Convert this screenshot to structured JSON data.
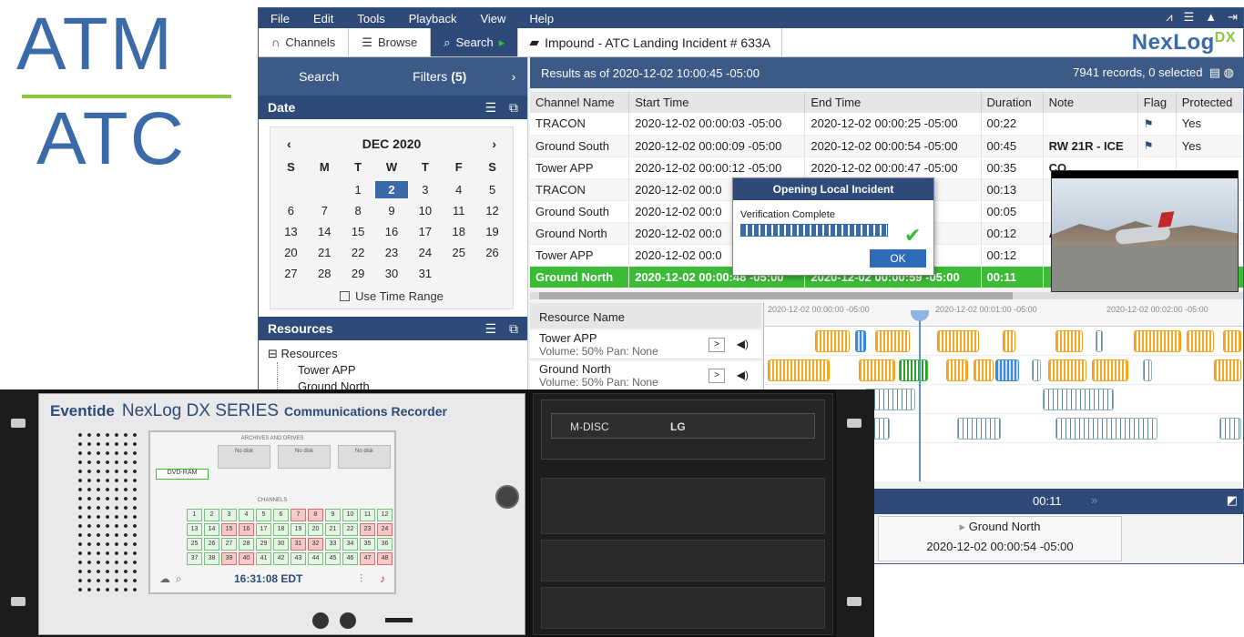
{
  "logo": {
    "top": "ATM",
    "bottom": "ATC"
  },
  "menu": [
    "File",
    "Edit",
    "Tools",
    "Playback",
    "View",
    "Help"
  ],
  "tabs": {
    "channels": "Channels",
    "browse": "Browse",
    "search": "Search",
    "document": "Impound - ATC Landing Incident # 633A"
  },
  "brand": {
    "name": "NexLog",
    "suffix": "DX"
  },
  "left_tabs": {
    "search": "Search",
    "filters": "Filters",
    "filters_count": "(5)"
  },
  "date_section": "Date",
  "calendar": {
    "month": "DEC 2020",
    "dow": [
      "S",
      "M",
      "T",
      "W",
      "T",
      "F",
      "S"
    ],
    "weeks": [
      [
        "",
        "",
        "1",
        "2",
        "3",
        "4",
        "5"
      ],
      [
        "6",
        "7",
        "8",
        "9",
        "10",
        "11",
        "12"
      ],
      [
        "13",
        "14",
        "15",
        "16",
        "17",
        "18",
        "19"
      ],
      [
        "20",
        "21",
        "22",
        "23",
        "24",
        "25",
        "26"
      ],
      [
        "27",
        "28",
        "29",
        "30",
        "31",
        "",
        ""
      ]
    ],
    "selected": "2",
    "use_time_range": "Use Time Range"
  },
  "resources_section": "Resources",
  "resource_tree": {
    "root": "Resources",
    "children": [
      "Tower APP",
      "Ground North"
    ]
  },
  "results": {
    "as_of": "Results as of 2020-12-02 10:00:45 -05:00",
    "count": "7941 records, 0 selected"
  },
  "columns": [
    "Channel Name",
    "Start Time",
    "End Time",
    "Duration",
    "Note",
    "Flag",
    "Protected"
  ],
  "rows": [
    {
      "channel": "TRACON",
      "start": "2020-12-02 00:00:03 -05:00",
      "end": "2020-12-02 00:00:25 -05:00",
      "dur": "00:22",
      "note": "",
      "flag": "⚑",
      "prot": "Yes"
    },
    {
      "channel": "Ground South",
      "start": "2020-12-02 00:00:09 -05:00",
      "end": "2020-12-02 00:00:54 -05:00",
      "dur": "00:45",
      "note": "RW 21R - ICE",
      "flag": "⚑",
      "prot": "Yes"
    },
    {
      "channel": "Tower APP",
      "start": "2020-12-02 00:00:12 -05:00",
      "end": "2020-12-02 00:00:47 -05:00",
      "dur": "00:35",
      "note": "CO",
      "flag": "",
      "prot": ""
    },
    {
      "channel": "TRACON",
      "start": "2020-12-02 00:0",
      "end": "5:00",
      "dur": "00:13",
      "note": "",
      "flag": "",
      "prot": ""
    },
    {
      "channel": "Ground South",
      "start": "2020-12-02 00:0",
      "end": "5:00",
      "dur": "00:05",
      "note": "",
      "flag": "",
      "prot": ""
    },
    {
      "channel": "Ground North",
      "start": "2020-12-02 00:0",
      "end": "5:00",
      "dur": "00:12",
      "note": "AL",
      "flag": "",
      "prot": ""
    },
    {
      "channel": "Tower APP",
      "start": "2020-12-02 00:0",
      "end": "5:00",
      "dur": "00:12",
      "note": "",
      "flag": "",
      "prot": ""
    },
    {
      "channel": "Ground North",
      "start": "2020-12-02 00:00:48 -05:00",
      "end": "2020-12-02 00:00:59 -05:00",
      "dur": "00:11",
      "note": "",
      "flag": "",
      "prot": ""
    }
  ],
  "modal": {
    "title": "Opening Local Incident",
    "message": "Verification Complete",
    "ok": "OK"
  },
  "resource_panel": {
    "header": "Resource Name",
    "items": [
      {
        "name": "Tower APP",
        "meta": "Volume:  50%    Pan: None"
      },
      {
        "name": "Ground North",
        "meta": "Volume:  50%    Pan: None"
      }
    ]
  },
  "timeline": {
    "ticks": [
      "2020-12-02 00:00:00 -05:00",
      "2020-12-02 00:01:00 -05:00",
      "2020-12-02 00:02:00 -05:00"
    ]
  },
  "playback": {
    "time": "00:11"
  },
  "info_card": {
    "channel": "Ground North",
    "time": "2020-12-02 00:00:54 -05:00"
  },
  "device": {
    "maker": "Eventide",
    "product": "NexLog DX SERIES",
    "title": "Communications Recorder",
    "archives_label": "ARCHIVES AND DRIVES",
    "drives": [
      "No disk",
      "No disk",
      "No disk"
    ],
    "dvdram": "DVD-RAM",
    "channels_label": "CHANNELS",
    "channels": [
      "1",
      "2",
      "3",
      "4",
      "5",
      "6",
      "7",
      "8",
      "9",
      "10",
      "11",
      "12",
      "13",
      "14",
      "15",
      "16",
      "17",
      "18",
      "19",
      "20",
      "21",
      "22",
      "23",
      "24",
      "25",
      "26",
      "27",
      "28",
      "29",
      "30",
      "31",
      "32",
      "33",
      "34",
      "35",
      "36",
      "37",
      "38",
      "39",
      "40",
      "41",
      "42",
      "43",
      "44",
      "45",
      "46",
      "47",
      "48"
    ],
    "red_channels": [
      "7",
      "8",
      "15",
      "16",
      "23",
      "24",
      "31",
      "32",
      "39",
      "40",
      "47",
      "48"
    ],
    "clock": "16:31:08 EDT",
    "disc_label": "M-DISC",
    "disc_brand": "LG"
  }
}
